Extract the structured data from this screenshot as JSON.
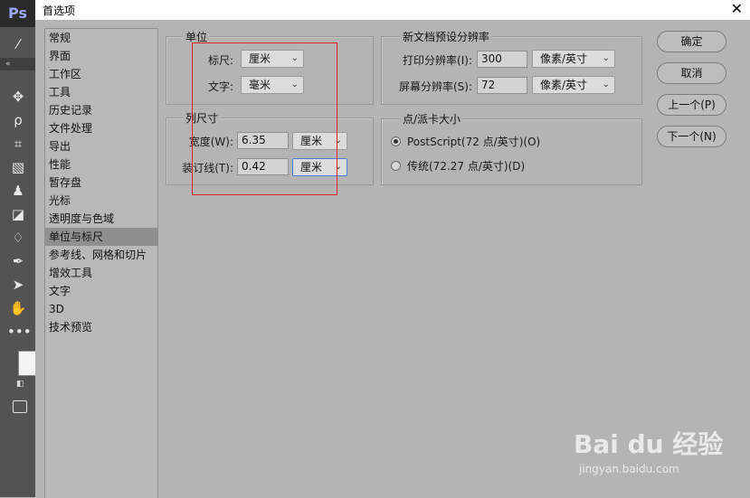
{
  "app": {
    "logo": "Ps"
  },
  "dialog": {
    "title": "首选项",
    "close": "✕"
  },
  "sidebar": {
    "items": [
      {
        "label": "常规"
      },
      {
        "label": "界面"
      },
      {
        "label": "工作区"
      },
      {
        "label": "工具"
      },
      {
        "label": "历史记录"
      },
      {
        "label": "文件处理"
      },
      {
        "label": "导出"
      },
      {
        "label": "性能"
      },
      {
        "label": "暂存盘"
      },
      {
        "label": "光标"
      },
      {
        "label": "透明度与色域"
      },
      {
        "label": "单位与标尺",
        "selected": true
      },
      {
        "label": "参考线、网格和切片"
      },
      {
        "label": "增效工具"
      },
      {
        "label": "文字"
      },
      {
        "label": "3D"
      },
      {
        "label": "技术预览"
      }
    ]
  },
  "units": {
    "legend": "单位",
    "ruler_label": "标尺:",
    "ruler_value": "厘米",
    "type_label": "文字:",
    "type_value": "毫米"
  },
  "column_size": {
    "legend": "列尺寸",
    "width_label": "宽度(W):",
    "width_value": "6.35",
    "width_unit": "厘米",
    "gutter_label": "装订线(T):",
    "gutter_value": "0.42",
    "gutter_unit": "厘米"
  },
  "new_doc": {
    "legend": "新文档预设分辨率",
    "print_label": "打印分辨率(I):",
    "print_value": "300",
    "print_unit": "像素/英寸",
    "screen_label": "屏幕分辨率(S):",
    "screen_value": "72",
    "screen_unit": "像素/英寸"
  },
  "point_size": {
    "legend": "点/派卡大小",
    "option1": "PostScript(72 点/英寸)(O)",
    "option2": "传统(72.27 点/英寸)(D)",
    "selected": "postscript"
  },
  "buttons": {
    "ok": "确定",
    "cancel": "取消",
    "prev": "上一个(P)",
    "next": "下一个(N)"
  },
  "watermark": {
    "logo": "Bai du 经验",
    "url": "jingyan.baidu.com"
  },
  "colors": {
    "highlight_box": "#e02020",
    "focus_border": "#4a7ad9"
  }
}
